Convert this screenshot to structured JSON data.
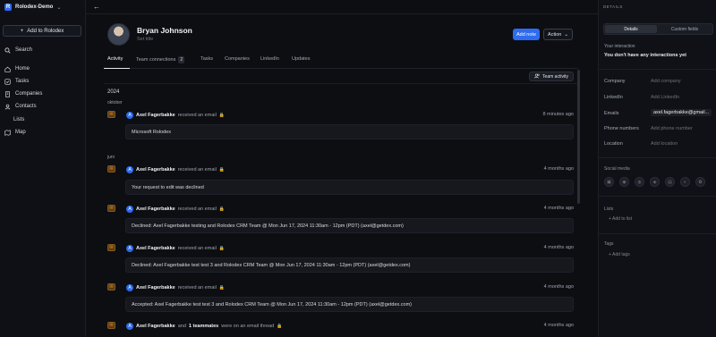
{
  "workspace": {
    "name": "Rolodex-Demo",
    "logo_letter": "R"
  },
  "sidebar": {
    "add_label": "Add to Rolodex",
    "search_label": "Search",
    "items": [
      {
        "label": "Home",
        "icon": "home-icon"
      },
      {
        "label": "Tasks",
        "icon": "tasks-icon"
      },
      {
        "label": "Companies",
        "icon": "building-icon"
      },
      {
        "label": "Contacts",
        "icon": "contacts-icon"
      },
      {
        "label": "Lists",
        "icon": ""
      },
      {
        "label": "Map",
        "icon": "map-icon"
      }
    ]
  },
  "person": {
    "name": "Bryan Johnson",
    "title_placeholder": "Set title"
  },
  "actions": {
    "add_note": "Add note",
    "action": "Action"
  },
  "tabs": [
    {
      "label": "Activity"
    },
    {
      "label": "Team connections",
      "count": "2"
    },
    {
      "label": "Tasks"
    },
    {
      "label": "Companies"
    },
    {
      "label": "LinkedIn"
    },
    {
      "label": "Updates"
    }
  ],
  "team_activity_label": "Team activity",
  "feed": {
    "year": "2024",
    "months": [
      "oktober",
      "juni"
    ],
    "events": [
      {
        "who": "Axel Fagerbakke",
        "action": "received an email",
        "time": "8 minutes ago",
        "body": "Microsoft Rolodex"
      },
      {
        "who": "Axel Fagerbakke",
        "action": "received an email",
        "time": "4 months ago",
        "body": "Your request to edit was declined"
      },
      {
        "who": "Axel Fagerbakke",
        "action": "received an email",
        "time": "4 months ago",
        "body": "Declined: Axel Fagerbakke testing and Rolodex CRM Team @ Mon Jun 17, 2024 11:30am - 12pm (PDT) (axel@getdex.com)"
      },
      {
        "who": "Axel Fagerbakke",
        "action": "received an email",
        "time": "4 months ago",
        "body": "Declined: Axel Fagerbakke test test 3 and Rolodex CRM Team @ Mon Jun 17, 2024 11:30am - 12pm (PDT) (axel@getdex.com)"
      },
      {
        "who": "Axel Fagerbakke",
        "action": "received an email",
        "time": "4 months ago",
        "body": "Accepted: Axel Fagerbakke test test 3 and Rolodex CRM Team @ Mon Jun 17, 2024 11:30am - 12pm (PDT) (axel@getdex.com)"
      },
      {
        "who": "Axel Fagerbakke",
        "and": "and",
        "teammates": "1 teammates",
        "action": "were on an email thread",
        "time": "4 months ago"
      }
    ]
  },
  "details": {
    "header": "DETAILS",
    "seg_details": "Details",
    "seg_custom": "Custom fields",
    "your_interaction_label": "Your interaction",
    "your_interaction_value": "You don't have any interactions yet",
    "fields": [
      {
        "label": "Company",
        "value": "Add company"
      },
      {
        "label": "LinkedIn",
        "value": "Add LinkedIn"
      },
      {
        "label": "Emails",
        "value": "axel.fagerbakke@gmail..."
      },
      {
        "label": "Phone numbers",
        "value": "Add phone number"
      },
      {
        "label": "Location",
        "value": "Add location"
      }
    ],
    "social_label": "Social media",
    "lists_label": "Lists",
    "add_to_list": "+ Add to list",
    "tags_label": "Tags",
    "add_tags": "+ Add tags"
  },
  "colors": {
    "accent": "#2d6cf0",
    "email_icon": "#f0a443"
  }
}
